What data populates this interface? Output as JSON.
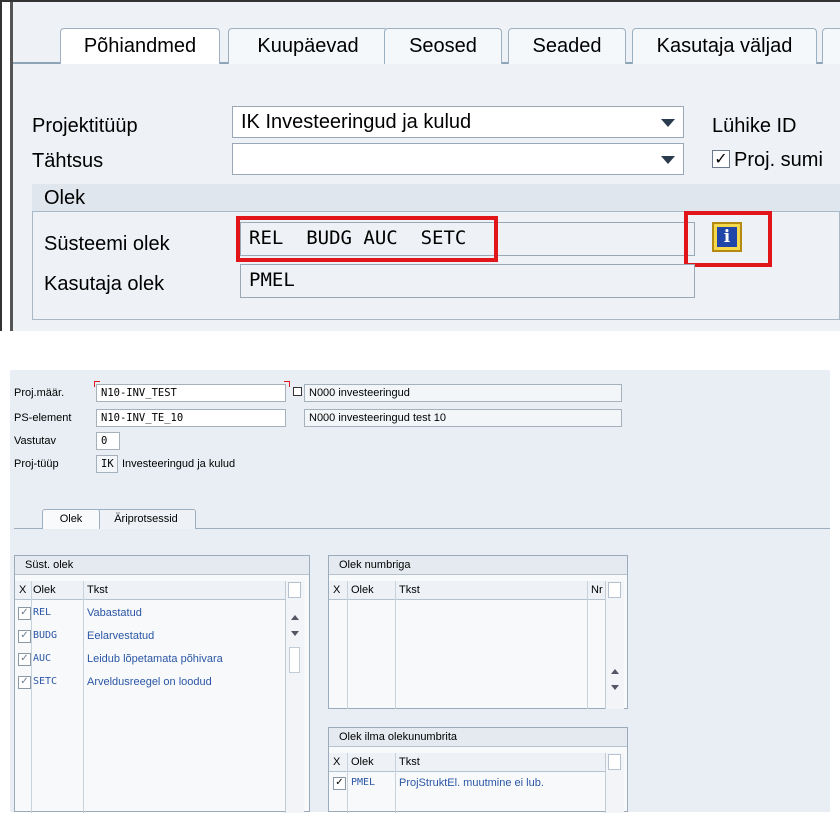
{
  "top": {
    "tabs": [
      {
        "label": "Põhiandmed",
        "active": true
      },
      {
        "label": "Kuupäevad"
      },
      {
        "label": "Seosed"
      },
      {
        "label": "Seaded"
      },
      {
        "label": "Kasutaja väljad"
      }
    ],
    "fields": {
      "projektituup_label": "Projektitüüp",
      "projektituup_value": "IK Investeeringud ja kulud",
      "tahtsus_label": "Tähtsus",
      "tahtsus_value": "",
      "luhike_id_label": "Lühike ID",
      "proj_sum_label": "Proj. sumi",
      "proj_sum_checked": true
    },
    "olek": {
      "group_label": "Olek",
      "systeemi_label": "Süsteemi olek",
      "systeemi_value": "REL  BUDG AUC  SETC",
      "kasutaja_label": "Kasutaja olek",
      "kasutaja_value": "PMEL",
      "info_icon": "info-icon"
    },
    "highlight_color": "#e0161b"
  },
  "bottom": {
    "header": {
      "proj_label": "Proj.määr.",
      "proj_value": "N10-INV_TEST",
      "proj_desc": "N000 investeeringud",
      "ps_label": "PS-element",
      "ps_value": "N10-INV_TE_10",
      "ps_desc": "N000 investeeringud  test 10",
      "vastutav_label": "Vastutav",
      "vastutav_value": "0",
      "tuup_label": "Proj-tüüp",
      "tuup_code": "IK",
      "tuup_text": "Investeeringud ja kulud"
    },
    "tabs": [
      {
        "label": "Olek",
        "active": true
      },
      {
        "label": "Äriprotsessid"
      }
    ],
    "syst": {
      "title": "Süst. olek",
      "columns": [
        "X",
        "Olek",
        "Tkst"
      ],
      "rows": [
        {
          "code": "REL",
          "text": "Vabastatud",
          "checked": true
        },
        {
          "code": "BUDG",
          "text": "Eelarvestatud",
          "checked": true
        },
        {
          "code": "AUC",
          "text": "Leidub lõpetamata põhivara",
          "checked": true
        },
        {
          "code": "SETC",
          "text": "Arveldusreegel on loodud",
          "checked": true
        }
      ]
    },
    "numbriga": {
      "title": "Olek numbriga",
      "columns": [
        "X",
        "Olek",
        "Tkst",
        "Nr"
      ]
    },
    "ilma": {
      "title": "Olek ilma olekunumbrita",
      "columns": [
        "X",
        "Olek",
        "Tkst"
      ],
      "rows": [
        {
          "code": "PMEL",
          "text": "ProjStruktEl. muutmine ei lub.",
          "checked": true
        }
      ]
    }
  }
}
